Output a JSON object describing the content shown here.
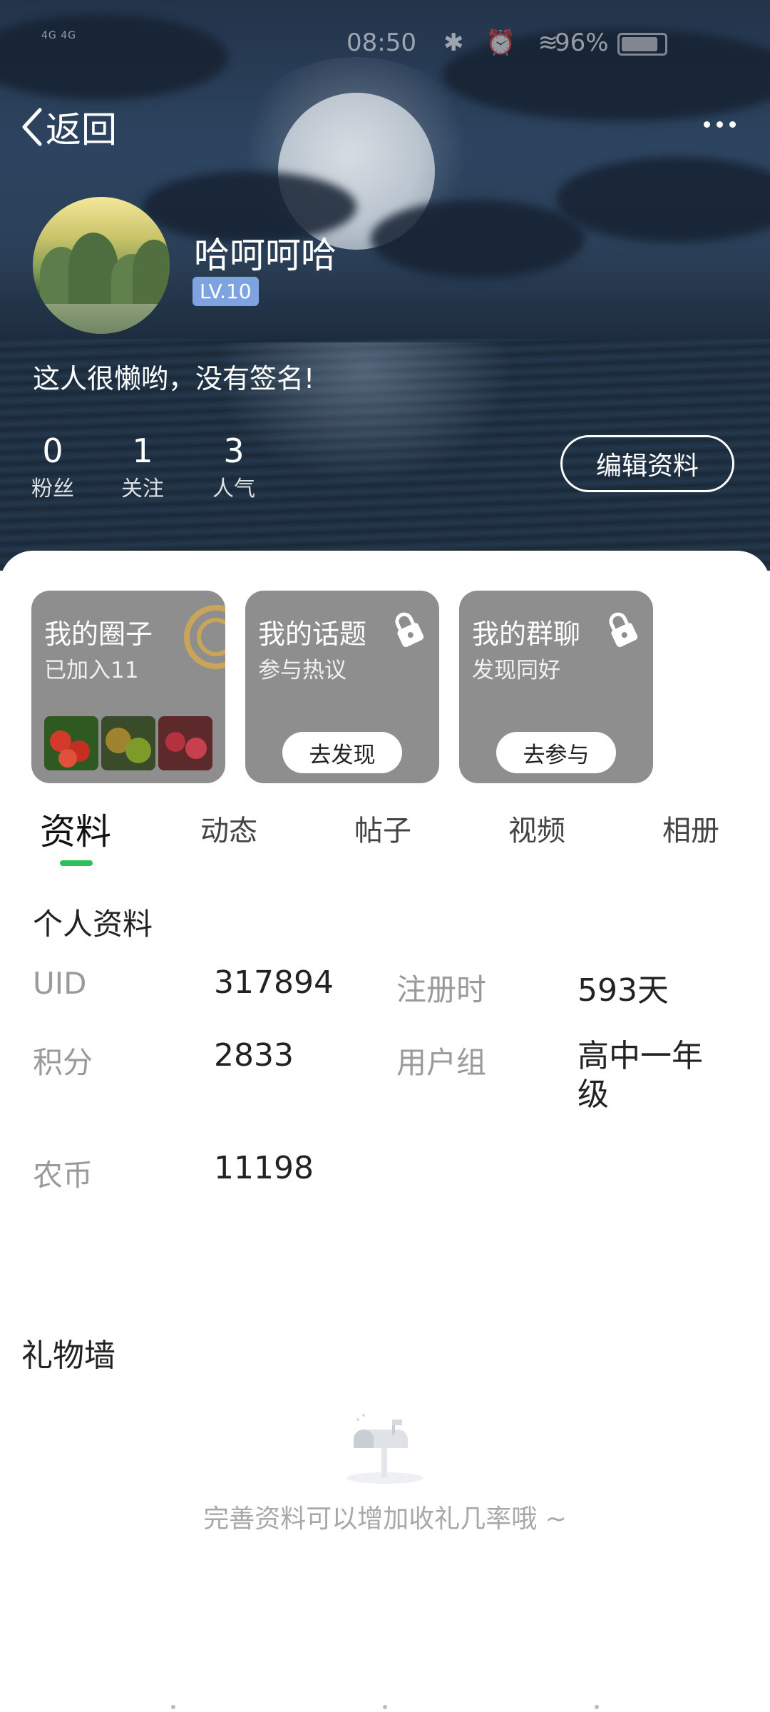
{
  "status_bar": {
    "signal": "4G 4G",
    "time": "08:50",
    "icons": "✱ ⏰ ≋",
    "battery": "96%",
    "battery_level": 0.96
  },
  "header": {
    "back_label": "返回"
  },
  "profile": {
    "username": "哈呵呵哈",
    "level": "LV.10",
    "signature": "这人很懒哟，没有签名!",
    "stats": [
      {
        "value": "0",
        "label": "粉丝"
      },
      {
        "value": "1",
        "label": "关注"
      },
      {
        "value": "3",
        "label": "人气"
      }
    ],
    "edit_button": "编辑资料"
  },
  "cards": [
    {
      "title": "我的圈子",
      "subtitle": "已加入11"
    },
    {
      "title": "我的话题",
      "subtitle": "参与热议",
      "button": "去发现"
    },
    {
      "title": "我的群聊",
      "subtitle": "发现同好",
      "button": "去参与"
    }
  ],
  "tabs": [
    "资料",
    "动态",
    "帖子",
    "视频",
    "相册"
  ],
  "active_tab": "资料",
  "info": {
    "section_title": "个人资料",
    "rows": [
      {
        "label": "UID",
        "value": "317894"
      },
      {
        "label": "注册时",
        "value": "593天"
      },
      {
        "label": "积分",
        "value": "2833"
      },
      {
        "label": "用户组",
        "value": "高中一年级"
      },
      {
        "label": "农币",
        "value": "11198"
      }
    ]
  },
  "gifts": {
    "title": "礼物墙",
    "empty_text": "完善资料可以增加收礼几率哦 ~"
  },
  "colors": {
    "accent": "#2fbf5d",
    "level_badge": "#7ea3e0",
    "card_bg": "#8e8e8e"
  }
}
